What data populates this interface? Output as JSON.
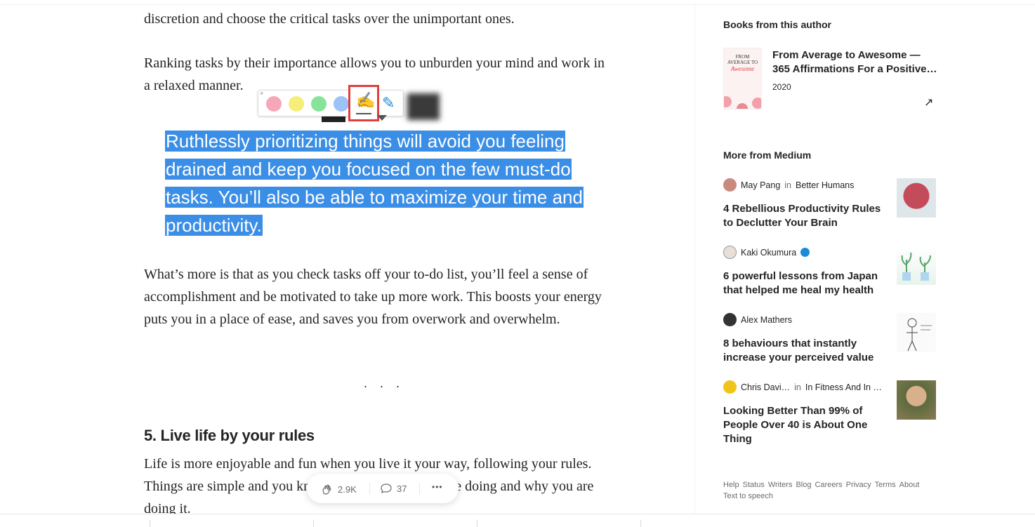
{
  "article": {
    "para_intro": "discretion and choose the critical tasks over the unimportant ones.",
    "para_ranking": "Ranking tasks by their importance allows you to unburden your mind and work in a relaxed manner.",
    "quote": "Ruthlessly prioritizing things will avoid you feeling drained and keep you focused on the few must-do tasks. You’ll also be able to maximize your time and productivity.",
    "para_whats_more": "What’s more is that as you check tasks off your to-do list, you’ll feel a sense of accomplishment and be motivated to take up more work. This boosts your energy puts you in a place of ease, and saves you from overwork and overwhelm.",
    "separator": "...",
    "heading": "5. Live life by your rules",
    "para_live": "Life is more enjoyable and fun when you live it your way, following your rules. Things are simple and you know fully well what you are doing and why you are doing it."
  },
  "highlighter": {
    "colors": [
      "#f7a8b8",
      "#f5ee7a",
      "#86e39a",
      "#9cc3f5"
    ],
    "close": "×"
  },
  "actions": {
    "claps": "2.9K",
    "responses": "37",
    "more": "•••"
  },
  "sidebar": {
    "books_heading": "Books from this author",
    "book": {
      "title": "From Average to Awesome — 365 Affirmations For a Positive Life",
      "title_line1": "From Average to Awesome —",
      "title_line2": "365 Affirmations For a Positive…",
      "year": "2020",
      "cover_top": "FROM AVERAGE TO",
      "cover_word": "Awesome"
    },
    "more_heading": "More from Medium",
    "stories": [
      {
        "author": "May Pang",
        "in": "in",
        "publication": "Better Humans",
        "title": "4 Rebellious Productivity Rules to Declutter Your Brain",
        "avatar_color": "#c98a7d",
        "thumb_color": "#c44b5a"
      },
      {
        "author": "Kaki Okumura",
        "in": "",
        "publication": "",
        "title": "6 powerful lessons from Japan that helped me heal my health",
        "avatar_color": "#e8e0d8",
        "thumb_color": "#cfe6d6"
      },
      {
        "author": "Alex Mathers",
        "in": "",
        "publication": "",
        "title": "8 behaviours that instantly increase your perceived value",
        "avatar_color": "#333333",
        "thumb_color": "#f1f1f1"
      },
      {
        "author": "Chris Davi…",
        "in": "in",
        "publication": "In Fitness And In …",
        "title": "Looking Better Than 99% of People Over 40 is About One Thing",
        "avatar_color": "#f0c419",
        "thumb_color": "#8a7a52"
      }
    ],
    "footer_links": [
      "Help",
      "Status",
      "Writers",
      "Blog",
      "Careers",
      "Privacy",
      "Terms",
      "About",
      "Text to speech"
    ]
  }
}
